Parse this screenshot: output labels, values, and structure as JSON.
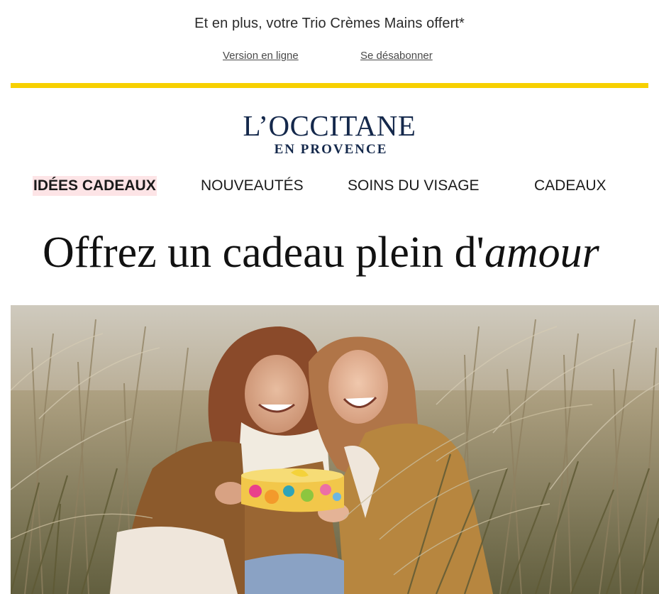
{
  "preheader": {
    "text": "Et en plus, votre Trio Crèmes Mains offert*",
    "links": {
      "online": "Version en ligne",
      "unsubscribe": "Se désabonner"
    }
  },
  "brand": {
    "name": "L’OCCITANE",
    "tagline": "EN PROVENCE",
    "color": "#14284b",
    "accent_bar_color": "#f7d000"
  },
  "nav": {
    "items": [
      {
        "label": "IDÉES CADEAUX",
        "active": true
      },
      {
        "label": "NOUVEAUTÉS",
        "active": false
      },
      {
        "label": "SOINS DU VISAGE",
        "active": false
      },
      {
        "label": "CADEAUX",
        "active": false
      }
    ],
    "active_highlight_color": "#fde4e6"
  },
  "hero": {
    "headline_main": "Offrez un cadeau plein d'",
    "headline_emphasis": "amour"
  }
}
